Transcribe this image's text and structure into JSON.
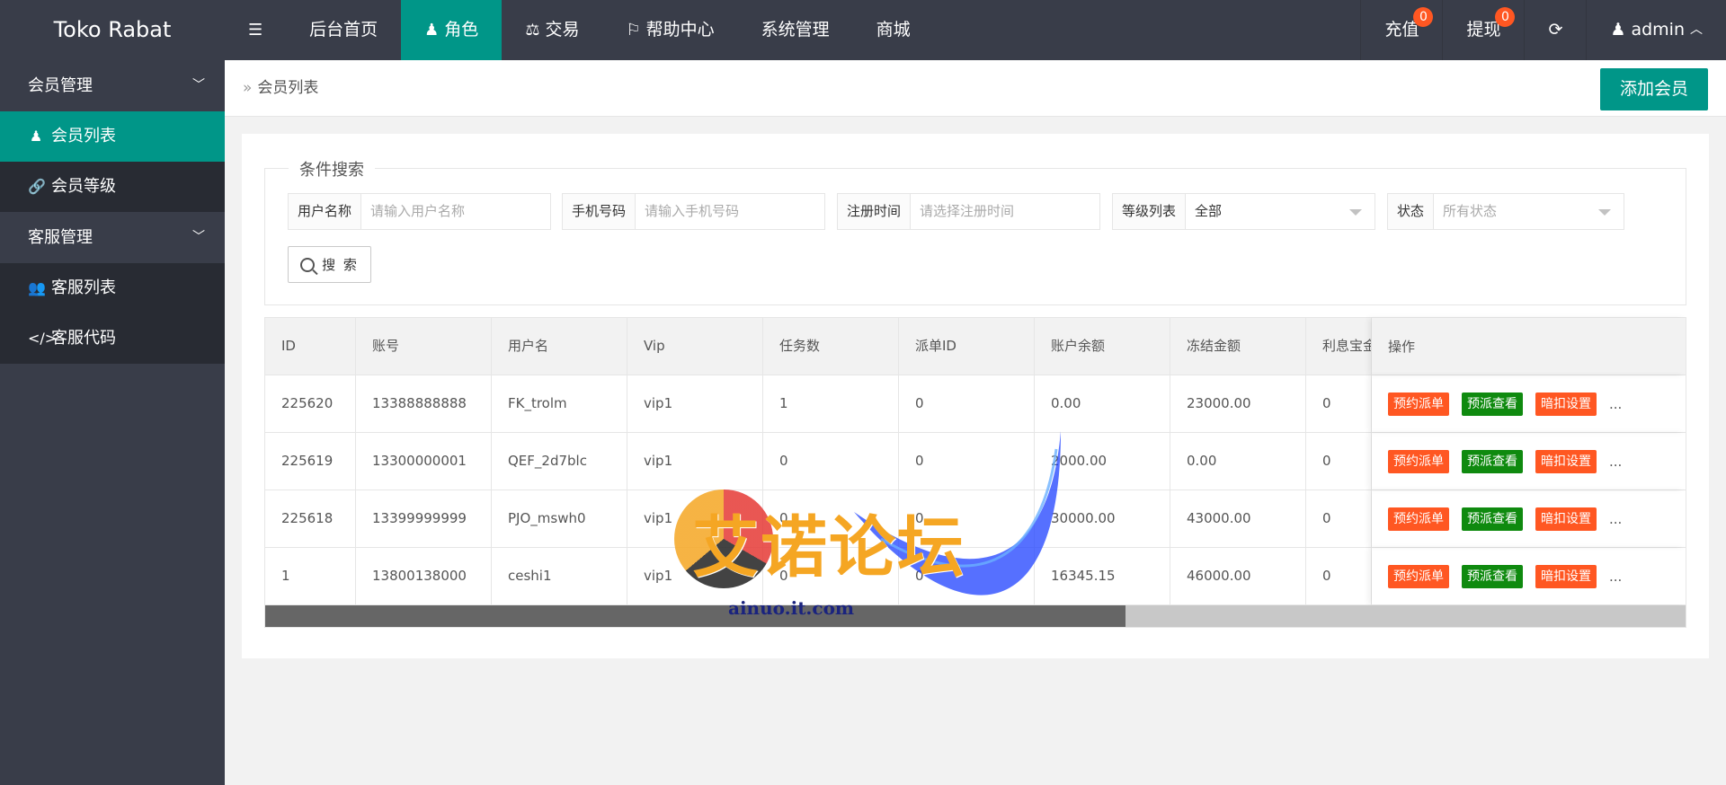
{
  "header": {
    "brand": "Toko Rabat",
    "nav": [
      {
        "label": "后台首页",
        "icon": "",
        "active": false
      },
      {
        "label": "角色",
        "icon": "user-icon",
        "active": true
      },
      {
        "label": "交易",
        "icon": "scale-icon",
        "active": false
      },
      {
        "label": "帮助中心",
        "icon": "flag-icon",
        "active": false
      },
      {
        "label": "系统管理",
        "icon": "",
        "active": false
      },
      {
        "label": "商城",
        "icon": "",
        "active": false
      }
    ],
    "recharge": {
      "label": "充值",
      "badge": "0"
    },
    "withdraw": {
      "label": "提现",
      "badge": "0"
    },
    "user": "admin"
  },
  "sidebar": {
    "groups": [
      {
        "label": "会员管理",
        "items": [
          {
            "label": "会员列表",
            "icon": "user-icon",
            "active": true
          },
          {
            "label": "会员等级",
            "icon": "link-icon",
            "active": false
          }
        ]
      },
      {
        "label": "客服管理",
        "items": [
          {
            "label": "客服列表",
            "icon": "users-icon",
            "active": false
          },
          {
            "label": "客服代码",
            "icon": "code-icon",
            "active": false
          }
        ]
      }
    ]
  },
  "breadcrumb": {
    "current": "会员列表"
  },
  "add_button": "添加会员",
  "search": {
    "legend": "条件搜索",
    "fields": [
      {
        "label": "用户名称",
        "placeholder": "请输入用户名称"
      },
      {
        "label": "手机号码",
        "placeholder": "请输入手机号码"
      },
      {
        "label": "注册时间",
        "placeholder": "请选择注册时间"
      },
      {
        "label": "等级列表",
        "value": "全部"
      },
      {
        "label": "状态",
        "placeholder": "所有状态"
      }
    ],
    "button": "搜 索"
  },
  "table": {
    "columns": [
      "ID",
      "账号",
      "用户名",
      "Vip",
      "任务数",
      "派单ID",
      "账户余额",
      "冻结金额",
      "利息宝金",
      "操作"
    ],
    "rows": [
      [
        "225620",
        "13388888888",
        "FK_trolm",
        "vip1",
        "1",
        "0",
        "0.00",
        "23000.00",
        "0"
      ],
      [
        "225619",
        "13300000001",
        "QEF_2d7blc",
        "vip1",
        "0",
        "0",
        "2000.00",
        "0.00",
        "0"
      ],
      [
        "225618",
        "13399999999",
        "PJO_mswh0",
        "vip1",
        "0",
        "0",
        "30000.00",
        "43000.00",
        "0"
      ],
      [
        "1",
        "13800138000",
        "ceshi1",
        "vip1",
        "0",
        "0",
        "16345.15",
        "46000.00",
        "0"
      ]
    ],
    "actions": [
      "预约派单",
      "预派查看",
      "暗扣设置"
    ],
    "more": "..."
  },
  "watermark": {
    "title": "艾诺论坛",
    "site": "ainuo.it.com"
  }
}
